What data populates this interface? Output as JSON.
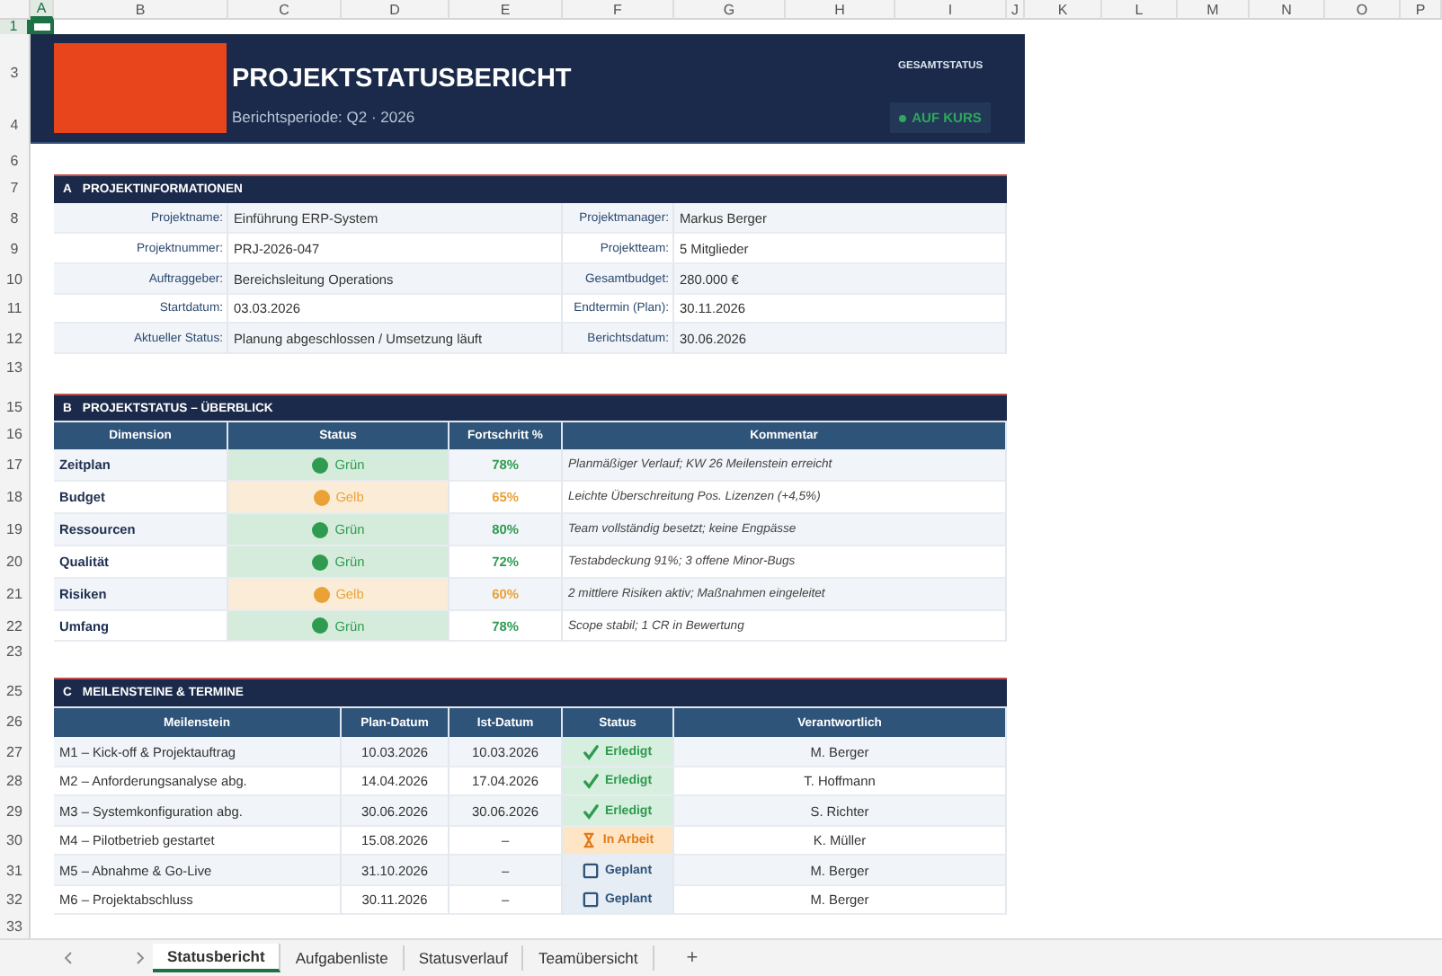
{
  "column_headers": [
    {
      "label": "A",
      "selected": true
    },
    {
      "label": "B",
      "selected": false
    },
    {
      "label": "C",
      "selected": false
    },
    {
      "label": "D",
      "selected": false
    },
    {
      "label": "E",
      "selected": false
    },
    {
      "label": "F",
      "selected": false
    },
    {
      "label": "G",
      "selected": false
    },
    {
      "label": "H",
      "selected": false
    },
    {
      "label": "I",
      "selected": false
    },
    {
      "label": "J",
      "selected": false
    },
    {
      "label": "K",
      "selected": false
    },
    {
      "label": "L",
      "selected": false
    },
    {
      "label": "M",
      "selected": false
    },
    {
      "label": "N",
      "selected": false
    },
    {
      "label": "O",
      "selected": false
    },
    {
      "label": "P",
      "selected": false
    }
  ],
  "row_headers": [
    {
      "label": "1",
      "selected": true
    },
    {
      "label": "3",
      "selected": false
    },
    {
      "label": "4",
      "selected": false
    },
    {
      "label": "6",
      "selected": false
    },
    {
      "label": "7",
      "selected": false
    },
    {
      "label": "8",
      "selected": false
    },
    {
      "label": "9",
      "selected": false
    },
    {
      "label": "10",
      "selected": false
    },
    {
      "label": "11",
      "selected": false
    },
    {
      "label": "12",
      "selected": false
    },
    {
      "label": "13",
      "selected": false
    },
    {
      "label": "15",
      "selected": false
    },
    {
      "label": "16",
      "selected": false
    },
    {
      "label": "17",
      "selected": false
    },
    {
      "label": "18",
      "selected": false
    },
    {
      "label": "19",
      "selected": false
    },
    {
      "label": "20",
      "selected": false
    },
    {
      "label": "21",
      "selected": false
    },
    {
      "label": "22",
      "selected": false
    },
    {
      "label": "23",
      "selected": false
    },
    {
      "label": "25",
      "selected": false
    },
    {
      "label": "26",
      "selected": false
    },
    {
      "label": "27",
      "selected": false
    },
    {
      "label": "28",
      "selected": false
    },
    {
      "label": "29",
      "selected": false
    },
    {
      "label": "30",
      "selected": false
    },
    {
      "label": "31",
      "selected": false
    },
    {
      "label": "32",
      "selected": false
    },
    {
      "label": "33",
      "selected": false
    }
  ],
  "banner": {
    "title": "PROJEKTSTATUSBERICHT",
    "period": "Berichtsperiode: Q2 · 2026",
    "status_label": "GESAMTSTATUS",
    "status": {
      "text": "AUF KURS",
      "color": "#2ea85a"
    }
  },
  "project_info": {
    "letter": "A",
    "title": "PROJEKTINFORMATIONEN",
    "rows": [
      {
        "left": {
          "label": "Projektname:",
          "value": "Einführung ERP-System"
        },
        "right": {
          "label": "Projektmanager:",
          "value": "Markus Berger"
        }
      },
      {
        "left": {
          "label": "Projektnummer:",
          "value": "PRJ-2026-047"
        },
        "right": {
          "label": "Projektteam:",
          "value": "5 Mitglieder"
        }
      },
      {
        "left": {
          "label": "Auftraggeber:",
          "value": "Bereichsleitung Operations"
        },
        "right": {
          "label": "Gesamtbudget:",
          "value": "280.000 €"
        }
      },
      {
        "left": {
          "label": "Startdatum:",
          "value": "03.03.2026"
        },
        "right": {
          "label": "Endtermin (Plan):",
          "value": "30.11.2026"
        }
      },
      {
        "left": {
          "label": "Aktueller Status:",
          "value": "Planung abgeschlossen / Umsetzung läuft"
        },
        "right": {
          "label": "Berichtsdatum:",
          "value": "30.06.2026"
        }
      }
    ]
  },
  "status_overview": {
    "letter": "B",
    "title": "PROJEKTSTATUS – ÜBERBLICK",
    "columns": [
      "Dimension",
      "Status",
      "Fortschritt %",
      "Kommentar"
    ],
    "rows": [
      {
        "dimension": "Zeitplan",
        "status": "Grün",
        "color": "#2e9b4f",
        "progress": "78%",
        "comment": "Planmäßiger Verlauf; KW 26 Meilenstein erreicht"
      },
      {
        "dimension": "Budget",
        "status": "Gelb",
        "color": "#eaa236",
        "progress": "65%",
        "comment": "Leichte Überschreitung Pos. Lizenzen (+4,5%)"
      },
      {
        "dimension": "Ressourcen",
        "status": "Grün",
        "color": "#2e9b4f",
        "progress": "80%",
        "comment": "Team vollständig besetzt; keine Engpässe"
      },
      {
        "dimension": "Qualität",
        "status": "Grün",
        "color": "#2e9b4f",
        "progress": "72%",
        "comment": "Testabdeckung 91%; 3 offene Minor-Bugs"
      },
      {
        "dimension": "Risiken",
        "status": "Gelb",
        "color": "#eaa236",
        "progress": "60%",
        "comment": "2 mittlere Risiken aktiv; Maßnahmen eingeleitet"
      },
      {
        "dimension": "Umfang",
        "status": "Grün",
        "color": "#2e9b4f",
        "progress": "78%",
        "comment": "Scope stabil; 1 CR in Bewertung"
      }
    ]
  },
  "milestones": {
    "letter": "C",
    "title": "MEILENSTEINE & TERMINE",
    "columns": [
      "Meilenstein",
      "Plan-Datum",
      "Ist-Datum",
      "Status",
      "Verantwortlich"
    ],
    "rows": [
      {
        "name": "M1 – Kick-off & Projektauftrag",
        "plan": "10.03.2026",
        "actual": "10.03.2026",
        "status": "Erledigt",
        "kind": "done",
        "owner": "M. Berger"
      },
      {
        "name": "M2 – Anforderungsanalyse abg.",
        "plan": "14.04.2026",
        "actual": "17.04.2026",
        "status": "Erledigt",
        "kind": "done",
        "owner": "T. Hoffmann"
      },
      {
        "name": "M3 – Systemkonfiguration abg.",
        "plan": "30.06.2026",
        "actual": "30.06.2026",
        "status": "Erledigt",
        "kind": "done",
        "owner": "S. Richter"
      },
      {
        "name": "M4 – Pilotbetrieb gestartet",
        "plan": "15.08.2026",
        "actual": "–",
        "status": "In Arbeit",
        "kind": "in_progress",
        "owner": "K. Müller"
      },
      {
        "name": "M5 – Abnahme & Go-Live",
        "plan": "31.10.2026",
        "actual": "–",
        "status": "Geplant",
        "kind": "planned",
        "owner": "M. Berger"
      },
      {
        "name": "M6 – Projektabschluss",
        "plan": "30.11.2026",
        "actual": "–",
        "status": "Geplant",
        "kind": "planned",
        "owner": "M. Berger"
      }
    ]
  },
  "sheet_tabs": [
    {
      "label": "Statusbericht",
      "selected": true
    },
    {
      "label": "Aufgabenliste",
      "selected": false
    },
    {
      "label": "Statusverlauf",
      "selected": false
    },
    {
      "label": "Teamübersicht",
      "selected": false
    }
  ],
  "add_tab": "+"
}
